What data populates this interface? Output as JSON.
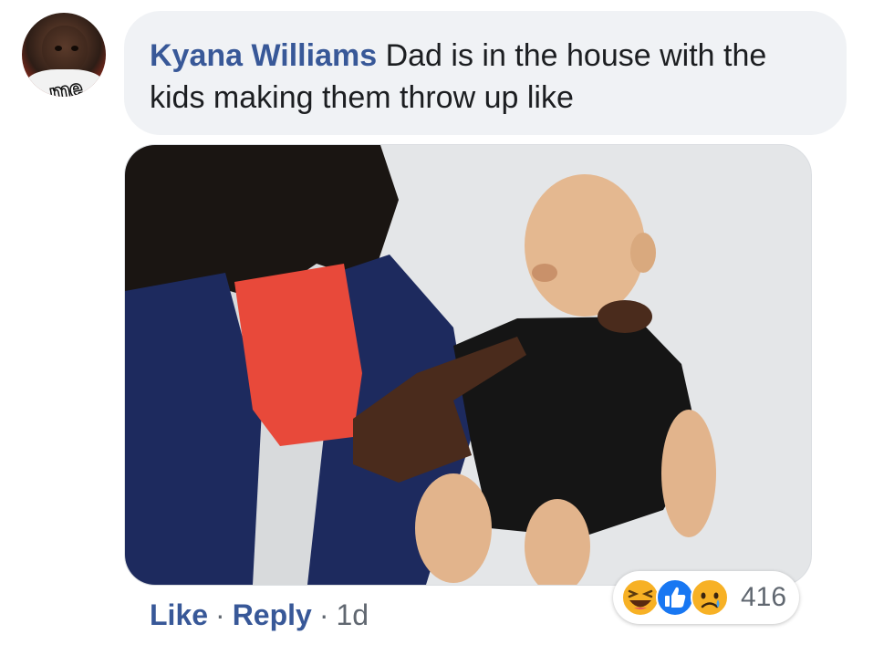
{
  "comment": {
    "author": "Kyana Williams",
    "text": "Dad is in the house with the kids making them throw up like",
    "avatar_label": "me"
  },
  "actions": {
    "like_label": "Like",
    "separator": "·",
    "reply_label": "Reply",
    "timestamp": "1d"
  },
  "reactions": {
    "icons": [
      "haha-icon",
      "like-icon",
      "sad-icon"
    ],
    "count": "416"
  },
  "colors": {
    "author": "#385898",
    "bubble_bg": "#f0f2f5",
    "meta_text": "#606770",
    "like_blue": "#1877f2",
    "haha_yellow": "#f7b125"
  }
}
